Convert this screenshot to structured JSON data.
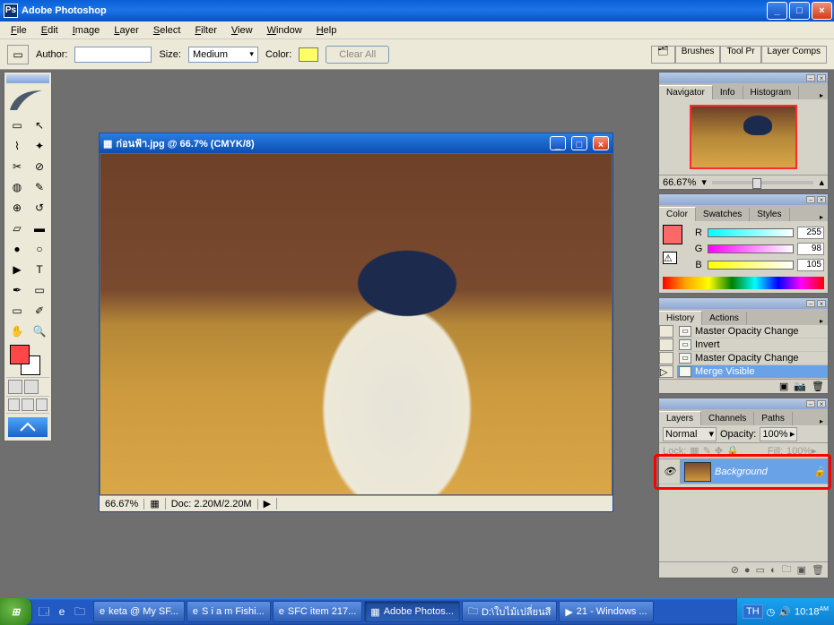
{
  "title": "Adobe Photoshop",
  "menubar": [
    "File",
    "Edit",
    "Image",
    "Layer",
    "Select",
    "Filter",
    "View",
    "Window",
    "Help"
  ],
  "options": {
    "author_label": "Author:",
    "author_value": "",
    "size_label": "Size:",
    "size_value": "Medium",
    "color_label": "Color:",
    "color_hex": "#ffff66",
    "clear_all": "Clear All",
    "palette_tabs": [
      "Brushes",
      "Tool Pr",
      "Layer Comps"
    ]
  },
  "document": {
    "title": "ก่อนฟ้า.jpg @ 66.7% (CMYK/8)",
    "zoom": "66.67%",
    "doc_info": "Doc: 2.20M/2.20M"
  },
  "navigator": {
    "tabs": [
      "Navigator",
      "Info",
      "Histogram"
    ],
    "active": 0,
    "zoom": "66.67%"
  },
  "color": {
    "tabs": [
      "Color",
      "Swatches",
      "Styles"
    ],
    "active": 0,
    "r": 255,
    "g": 98,
    "b": 105,
    "fg_hex": "#ff6868"
  },
  "history": {
    "tabs": [
      "History",
      "Actions"
    ],
    "active": 0,
    "items": [
      {
        "label": "Master Opacity Change",
        "selected": false
      },
      {
        "label": "Invert",
        "selected": false
      },
      {
        "label": "Master Opacity Change",
        "selected": false
      },
      {
        "label": "Merge Visible",
        "selected": true
      }
    ]
  },
  "layers": {
    "tabs": [
      "Layers",
      "Channels",
      "Paths"
    ],
    "active": 0,
    "blend_mode": "Normal",
    "opacity_label": "Opacity:",
    "opacity": "100%",
    "fill_label": "Fill:",
    "fill": "100%",
    "items": [
      {
        "name": "Background",
        "locked": true,
        "visible": true,
        "selected": true
      }
    ]
  },
  "taskbar": {
    "tasks": [
      {
        "label": "keta @ My SF...",
        "icon": "e",
        "active": false
      },
      {
        "label": "S i a m Fishi...",
        "icon": "e",
        "active": false
      },
      {
        "label": "SFC item 217...",
        "icon": "e",
        "active": false
      },
      {
        "label": "Adobe Photos...",
        "icon": "ps",
        "active": true
      },
      {
        "label": "D:\\ใบไม้เปลี่ยนสี",
        "icon": "f",
        "active": false
      },
      {
        "label": "21 - Windows ...",
        "icon": "w",
        "active": false
      }
    ],
    "lang": "TH",
    "time": "10:18",
    "ampm": "AM"
  }
}
